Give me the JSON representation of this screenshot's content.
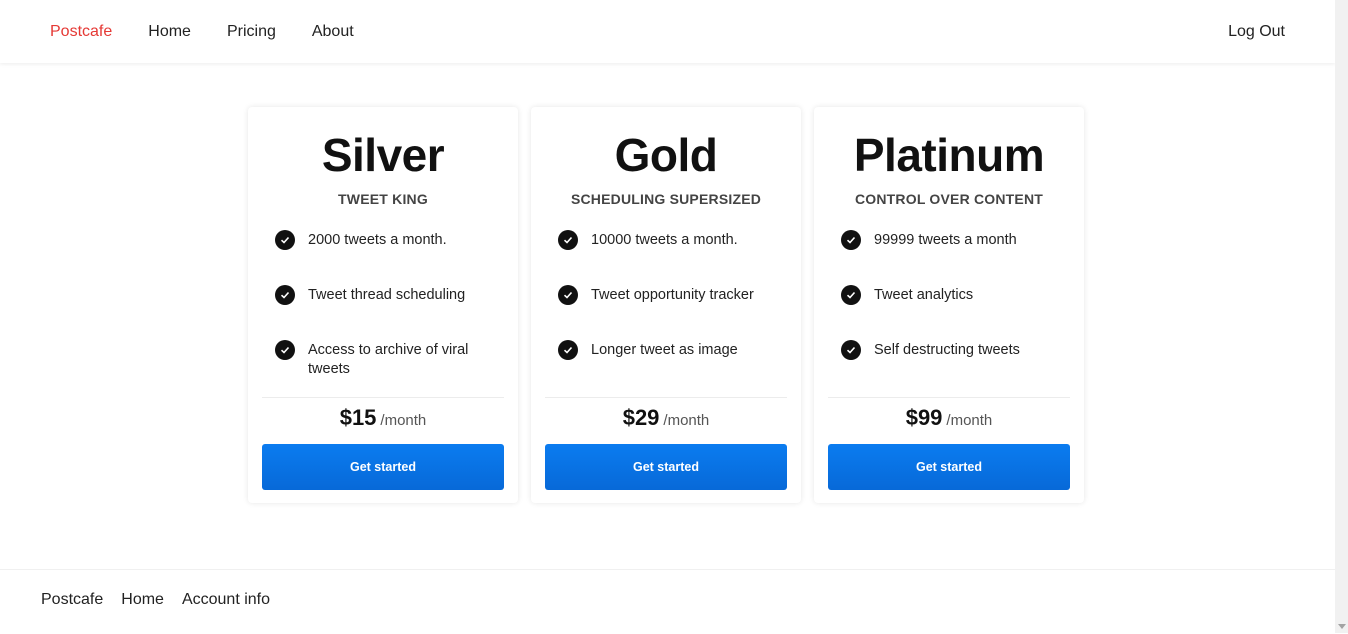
{
  "nav": {
    "brand": "Postcafe",
    "links": [
      "Home",
      "Pricing",
      "About"
    ],
    "logout": "Log Out"
  },
  "plans": [
    {
      "title": "Silver",
      "subtitle": "TWEET KING",
      "features": [
        "2000 tweets a month.",
        "Tweet thread scheduling",
        "Access to archive of viral tweets"
      ],
      "price": "$15",
      "period": "/month",
      "cta": "Get started"
    },
    {
      "title": "Gold",
      "subtitle": "SCHEDULING SUPERSIZED",
      "features": [
        "10000 tweets a month.",
        "Tweet opportunity tracker",
        "Longer tweet as image"
      ],
      "price": "$29",
      "period": "/month",
      "cta": "Get started"
    },
    {
      "title": "Platinum",
      "subtitle": "CONTROL OVER CONTENT",
      "features": [
        "99999 tweets a month",
        "Tweet analytics",
        "Self destructing tweets"
      ],
      "price": "$99",
      "period": "/month",
      "cta": "Get started"
    }
  ],
  "footer": {
    "brand": "Postcafe",
    "links": [
      "Home",
      "Account info"
    ]
  },
  "colors": {
    "brand": "#e53935",
    "cta": "#0a74e6"
  }
}
